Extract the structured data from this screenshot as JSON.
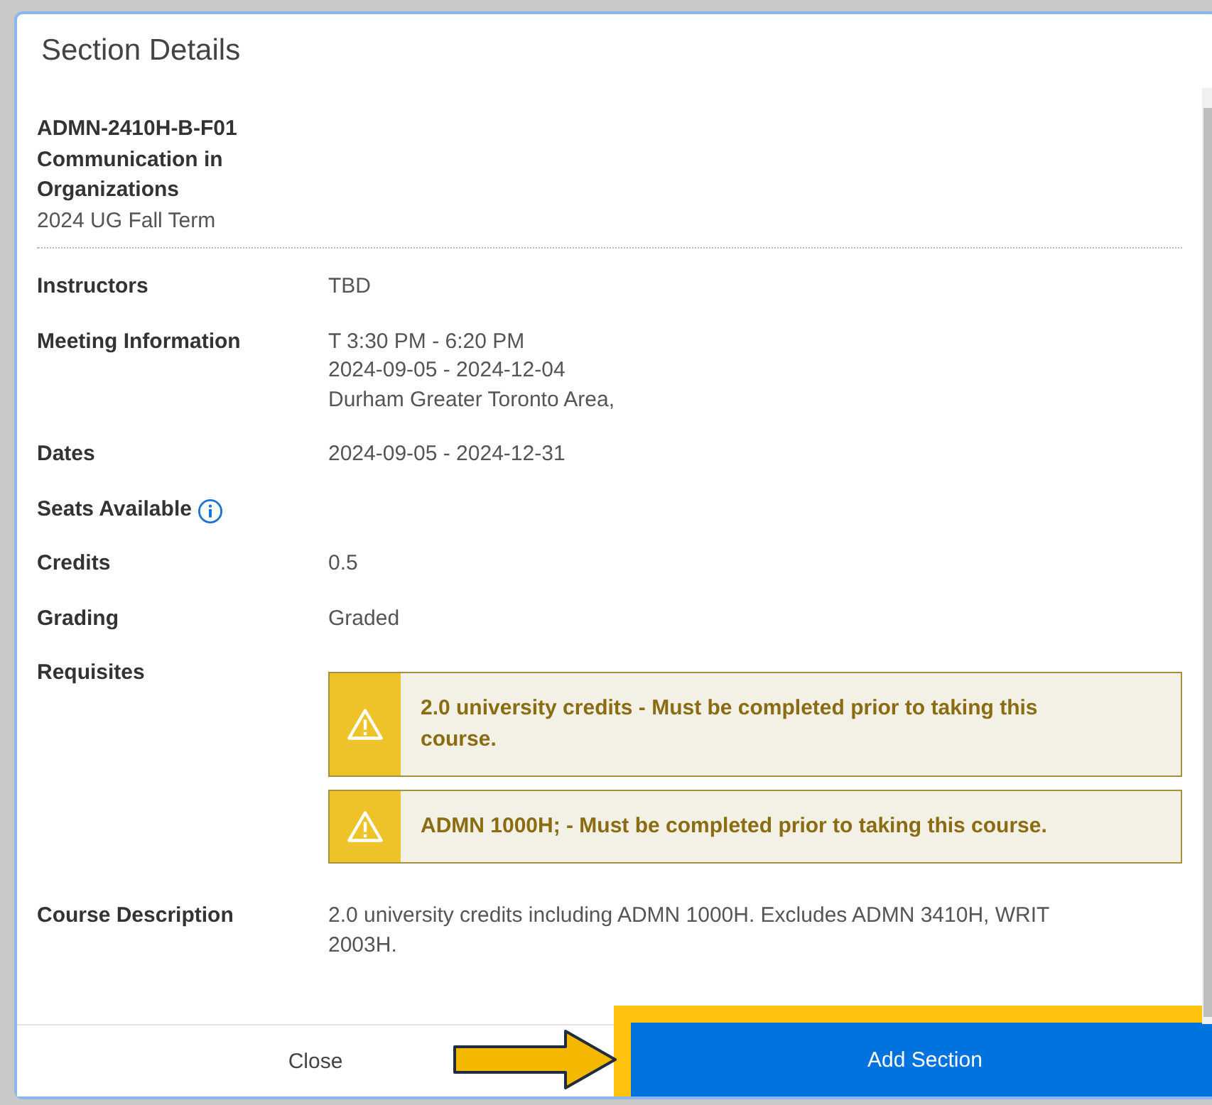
{
  "dialog": {
    "title": "Section Details"
  },
  "section": {
    "code": "ADMN-2410H-B-F01",
    "name": "Communication in Organizations",
    "term": "2024 UG Fall Term"
  },
  "details": [
    {
      "kind": "text",
      "label": "Instructors",
      "lines": [
        "TBD"
      ]
    },
    {
      "kind": "text",
      "label": "Meeting Information",
      "lines": [
        "T 3:30 PM - 6:20 PM",
        "2024-09-05 - 2024-12-04",
        "Durham Greater Toronto Area,"
      ]
    },
    {
      "kind": "text",
      "label": "Dates",
      "lines": [
        "2024-09-05 - 2024-12-31"
      ]
    },
    {
      "kind": "info",
      "label": "Seats Available"
    },
    {
      "kind": "text",
      "label": "Credits",
      "lines": [
        "0.5"
      ]
    },
    {
      "kind": "text",
      "label": "Grading",
      "lines": [
        "Graded"
      ]
    },
    {
      "kind": "requisites",
      "label": "Requisites",
      "alerts": [
        "2.0 university credits - Must be completed prior to taking this course.",
        "ADMN 1000H; - Must be completed prior to taking this course."
      ]
    },
    {
      "kind": "text",
      "label": "Course Description",
      "lines": [
        "2.0 university credits including ADMN 1000H. Excludes ADMN 3410H, WRIT 2003H."
      ]
    }
  ],
  "footer": {
    "close": "Close",
    "add": "Add Section",
    "add_highlighted": true
  }
}
